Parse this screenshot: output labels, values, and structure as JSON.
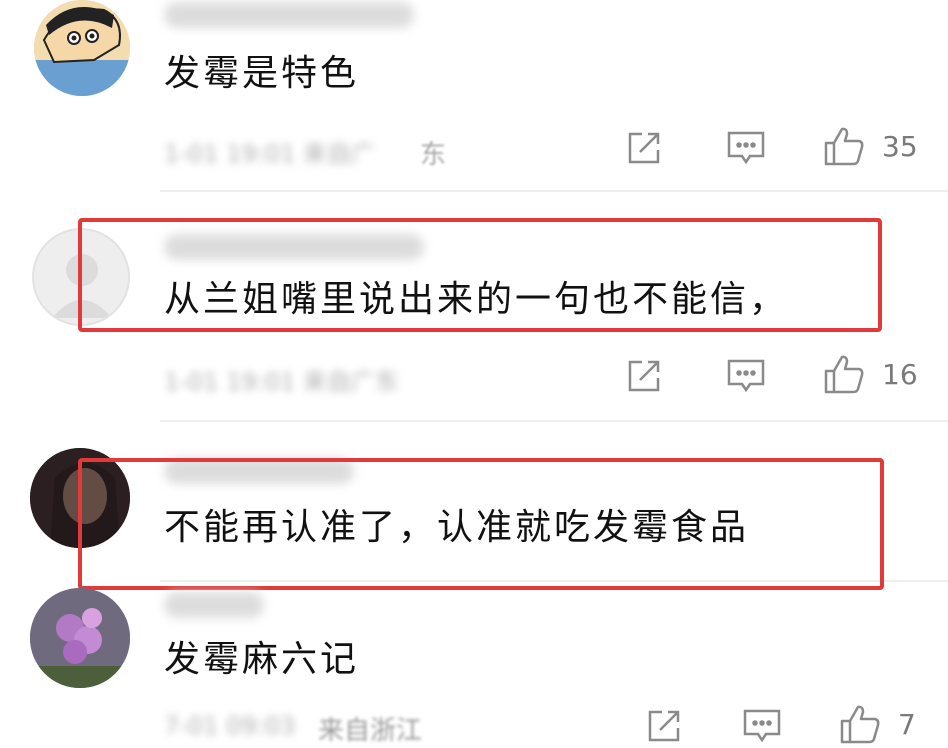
{
  "comments": [
    {
      "text": "发霉是特色",
      "like_count": "35",
      "location": "东",
      "highlighted": false
    },
    {
      "text": "从兰姐嘴里说出来的一句也不能信，",
      "like_count": "16",
      "location": "",
      "highlighted": true
    },
    {
      "text": "不能再认准了，认准就吃发霉食品",
      "like_count": "",
      "location": "",
      "highlighted": true
    },
    {
      "text": "发霉麻六记",
      "like_count": "7",
      "location": "来自浙江",
      "highlighted": false
    }
  ],
  "icons": {
    "share": "share-icon",
    "reply": "comment-icon",
    "like": "thumbs-up-icon"
  },
  "colors": {
    "highlight_border": "#e23a3a",
    "icon": "#8a8a8a"
  }
}
